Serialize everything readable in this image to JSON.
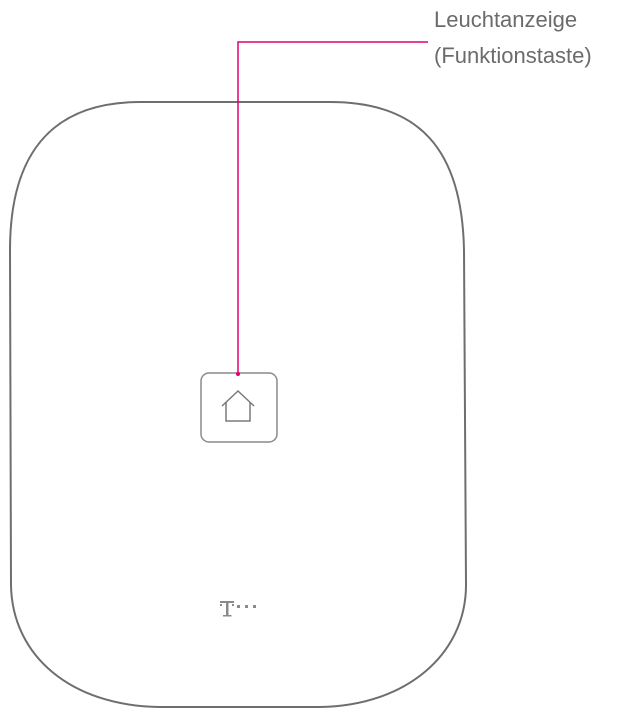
{
  "callout": {
    "line1": "Leuchtanzeige",
    "line2": "(Funktionstaste)",
    "color": "#e20074"
  },
  "device": {
    "outline_color": "#6e6e6e",
    "button_icon": "home-icon",
    "brand_mark": "telekom-logo-icon",
    "brand_color": "#8a8a8a"
  }
}
